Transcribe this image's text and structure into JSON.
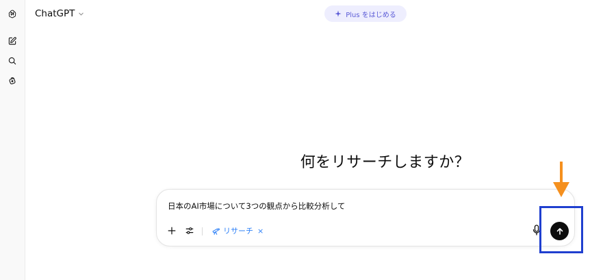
{
  "header": {
    "model_name": "ChatGPT",
    "plus_label": "Plus をはじめる"
  },
  "sidebar": {
    "icons": [
      "openai-logo-icon",
      "new-chat-icon",
      "search-icon",
      "library-icon"
    ]
  },
  "main": {
    "headline": "何をリサーチしますか？"
  },
  "composer": {
    "prompt_text": "日本のAI市場について3つの観点から比較分析して",
    "research_chip_label": "リサーチ",
    "research_chip_close": "×"
  },
  "colors": {
    "accent": "#2f81f7",
    "plus_bg": "#eeeefe",
    "plus_text": "#5b5bd6",
    "send_bg": "#0d0d0d",
    "annotation_box": "#1f3fcf",
    "annotation_arrow": "#f5901e"
  }
}
